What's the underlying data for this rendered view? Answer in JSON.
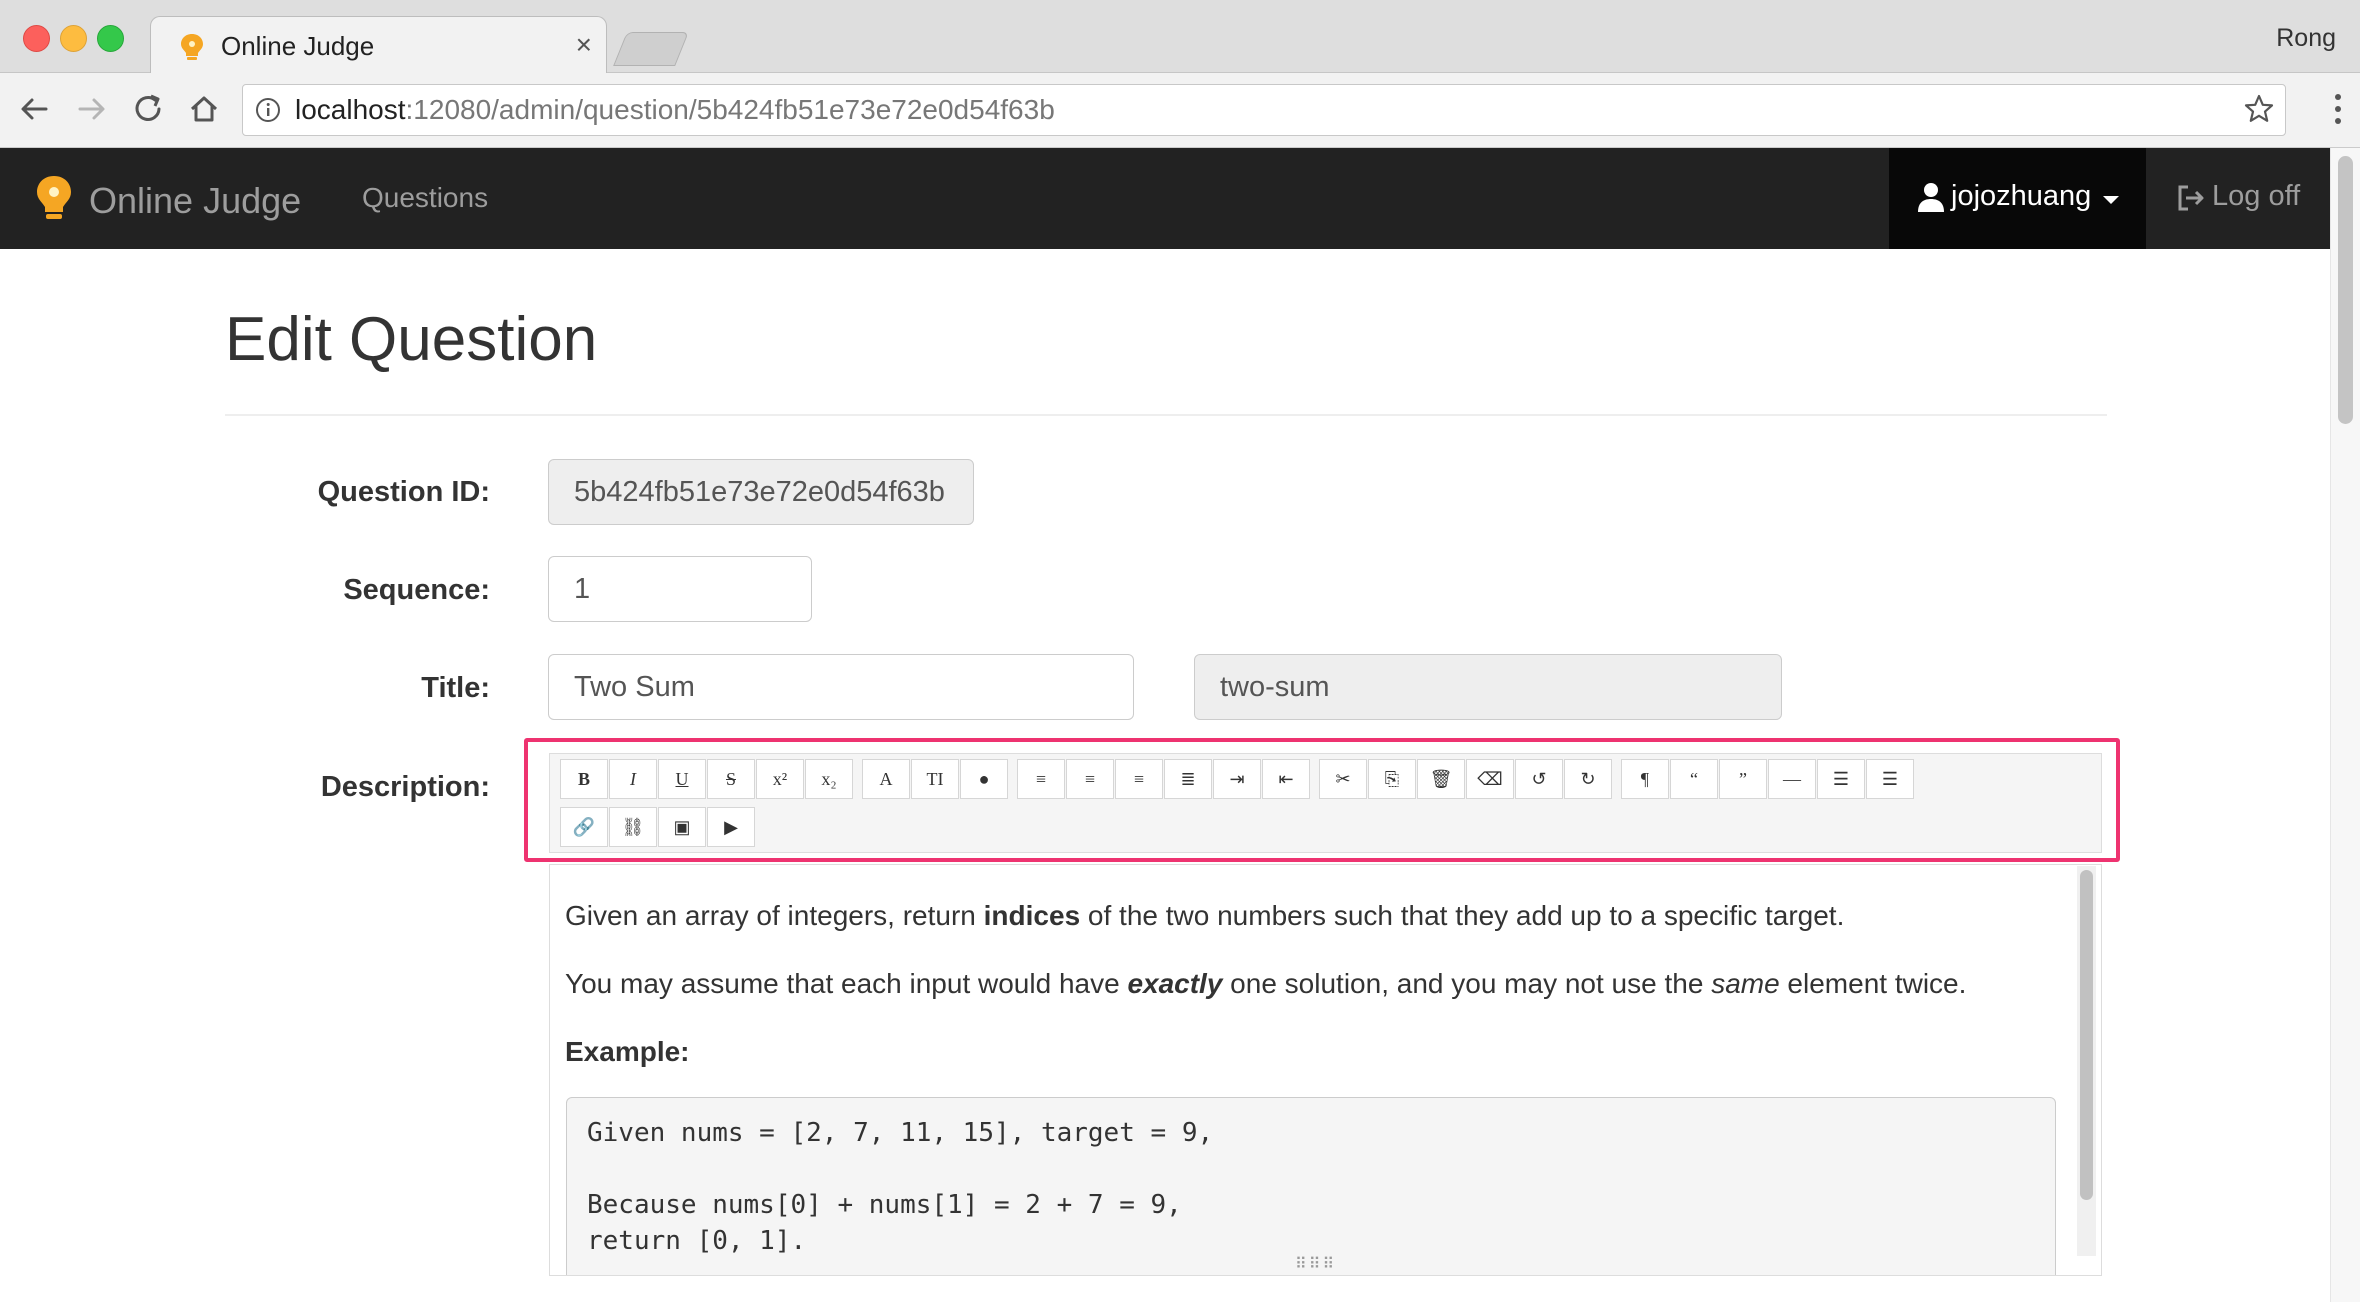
{
  "browser": {
    "tab_title": "Online Judge",
    "tab_close": "×",
    "profile_name": "Rong",
    "url_host": "localhost",
    "url_rest": ":12080/admin/question/5b424fb51e73e72e0d54f63b"
  },
  "navbar": {
    "brand": "Online Judge",
    "questions_link": "Questions",
    "username": "jojozhuang",
    "logoff": "Log off"
  },
  "page": {
    "title": "Edit Question"
  },
  "form": {
    "question_id_label": "Question ID:",
    "question_id_value": "5b424fb51e73e72e0d54f63b",
    "sequence_label": "Sequence:",
    "sequence_value": "1",
    "title_label": "Title:",
    "title_value": "Two Sum",
    "slug_value": "two-sum",
    "description_label": "Description:"
  },
  "toolbar": {
    "buttons": [
      {
        "name": "bold-button",
        "glyph": "B"
      },
      {
        "name": "italic-button",
        "glyph": "I"
      },
      {
        "name": "underline-button",
        "glyph": "U"
      },
      {
        "name": "strikethrough-button",
        "glyph": "S"
      },
      {
        "name": "superscript-button",
        "glyph": "x²"
      },
      {
        "name": "subscript-button",
        "glyph": "x₂"
      },
      {
        "name": "font-button",
        "glyph": "A"
      },
      {
        "name": "font-size-button",
        "glyph": "TI"
      },
      {
        "name": "color-button",
        "glyph": "●"
      },
      {
        "name": "align-left-button",
        "glyph": "≡"
      },
      {
        "name": "align-center-button",
        "glyph": "≡"
      },
      {
        "name": "align-right-button",
        "glyph": "≡"
      },
      {
        "name": "justify-button",
        "glyph": "≣"
      },
      {
        "name": "indent-button",
        "glyph": "⇥"
      },
      {
        "name": "outdent-button",
        "glyph": "⇤"
      },
      {
        "name": "cut-button",
        "glyph": "✂"
      },
      {
        "name": "copy-button",
        "glyph": "⎘"
      },
      {
        "name": "delete-button",
        "glyph": "🗑"
      },
      {
        "name": "eraser-button",
        "glyph": "⌫"
      },
      {
        "name": "undo-button",
        "glyph": "↺"
      },
      {
        "name": "redo-button",
        "glyph": "↻"
      },
      {
        "name": "paragraph-button",
        "glyph": "¶"
      },
      {
        "name": "quote-open-button",
        "glyph": "“"
      },
      {
        "name": "quote-close-button",
        "glyph": "”"
      },
      {
        "name": "horizontal-rule-button",
        "glyph": "—"
      },
      {
        "name": "bullet-list-button",
        "glyph": "☰"
      },
      {
        "name": "numbered-list-button",
        "glyph": "☰"
      },
      {
        "name": "link-button",
        "glyph": "🔗"
      },
      {
        "name": "unlink-button",
        "glyph": "⛓"
      },
      {
        "name": "image-button",
        "glyph": "▣"
      },
      {
        "name": "video-button",
        "glyph": "▶"
      }
    ]
  },
  "description": {
    "p1_a": "Given an array of integers, return ",
    "p1_b": "indices",
    "p1_c": " of the two numbers such that they add up to a specific target.",
    "p2_a": "You may assume that each input would have ",
    "p2_b": "exactly",
    "p2_c": " one solution, and you may not use the ",
    "p2_d": "same",
    "p2_e": " element twice.",
    "example_heading": "Example:",
    "code_line1": "Given nums = [2, 7, 11, 15], target = 9,",
    "code_line2": "Because nums[0] + nums[1] = 2 + 7 = 9,",
    "code_line3": "return [0, 1]."
  },
  "colors": {
    "navbar_bg": "#222222",
    "highlight_border": "#ee3370"
  }
}
